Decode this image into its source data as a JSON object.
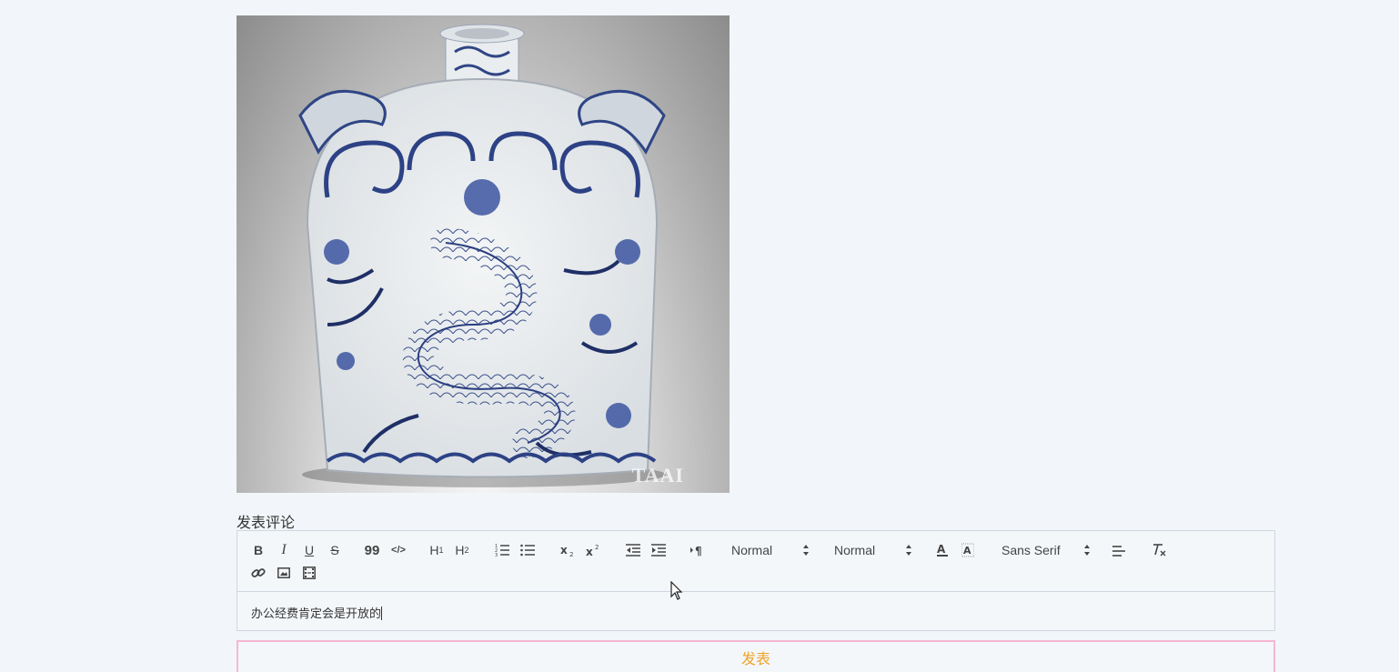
{
  "image": {
    "alt": "青花瓷扁壶",
    "watermark": "TAAI"
  },
  "comment_section": {
    "title": "发表评论",
    "editor_text": "办公经费肯定会是开放的",
    "submit_label": "发表"
  },
  "toolbar": {
    "bold": "B",
    "italic": "I",
    "underline": "U",
    "strike": "S",
    "blockquote": "99",
    "code": "</>",
    "h1": "H1",
    "h2": "H2",
    "header_picker": "Normal",
    "size_picker": "Normal",
    "font_picker": "Sans Serif"
  },
  "colors": {
    "background": "#f2f6fa",
    "submit_text": "#f0a32a",
    "submit_border": "#f7b6d2"
  }
}
